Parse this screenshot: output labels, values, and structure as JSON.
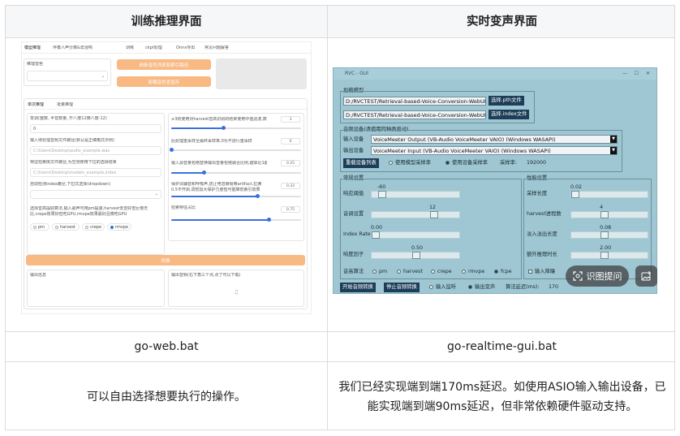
{
  "headers": {
    "training": "训练推理界面",
    "realtime": "实时变声界面"
  },
  "files": {
    "web": "go-web.bat",
    "gui": "go-realtime-gui.bat"
  },
  "descriptions": {
    "web": "可以自由选择想要执行的操作。",
    "gui": "我们已经实现端到端170ms延迟。如使用ASIO输入输出设备，已能实现端到端90ms延迟，但非常依赖硬件驱动支持。"
  },
  "web_ui": {
    "tabs": [
      "模型推理",
      "伴奏人声分离&去混响",
      "训练",
      "ckpt处理",
      "Onnx导出",
      "常见问题解答"
    ],
    "model_label": "推理音色",
    "refresh_button": "刷新音色列表和索引路径",
    "unload_button": "卸载音色省显存",
    "subtabs": [
      "单次推理",
      "批量推理"
    ],
    "left_labels": [
      "变调(整数, 半音数量, 升八度12降八度-12)",
      "输入待处理音频文件路径(默认是正确格式示例)",
      "特征检索库文件路径,为空则使用下拉的选择结果",
      "自动检测index路径,下拉式选择(dropdown)",
      "选择音高提取算法,输入歌声可用pm提速,harvest低音好但巨慢无比,crepe效果好但吃GPU,rmvpe效果最好且微吃GPU"
    ],
    "pitch_value": "0",
    "audio_path": "C:\\Users\\Desktop\\audio_example.wav",
    "index_path": "C:\\Users\\Desktop\\models_example.index",
    "algos": [
      "pm",
      "harvest",
      "crepe",
      "rmvpe"
    ],
    "selected_algo": "rmvpe",
    "right_labels": [
      "≥3则使用对harvest音高识别的结果使用中值滤波,数值为滤波半径,使用可以削弱哑音",
      "后处理重采样至最终采样率,0为不进行重采样",
      "输入源音量包络替换输出音量包络融合比例,越靠近1越使用输出包络",
      "保护清辅音和呼吸声,防止电音撕裂等artifact,拉满0.5不开启,调低加大保护力度但可能降低索引效果",
      "检索特征占比"
    ],
    "right_values": [
      "3",
      "0",
      "0.25",
      "0.33",
      "0.75"
    ],
    "right_fracs": [
      0.4,
      0,
      0.25,
      0.66,
      0.75
    ],
    "convert_button": "转换",
    "output_info": "输出信息",
    "output_audio": "输出音频(右下角三个点,点了可以下载)"
  },
  "gui_ui": {
    "title": "RVC - GUI",
    "load_model": "加载模型",
    "pth_path": "D:/RVCTEST/Retrieval-based-Voice-Conversion-WebUI",
    "index_path": "D:/RVCTEST/Retrieval-based-Voice-Conversion-WebUI",
    "pth_button": "选择.pth文件",
    "index_button": "选择.index文件",
    "audio_device": "音频设备(请使用同种类驱动)",
    "input_label": "输入设备",
    "output_label": "输出设备",
    "input_device": "VoiceMeeter Output (VB-Audio VoiceMeeter VAIO) (Windows WASAPI)",
    "output_device": "VoiceMeeter Input (VB-Audio VoiceMeeter VAIO) (Windows WASAPI)",
    "reload_button": "重载设备列表",
    "sr_model": "使用模型采样率",
    "sr_device": "使用设备采样率",
    "sr_label": "采样率:",
    "sr_value": "192000",
    "general": "常规设置",
    "perf": "性能设置",
    "left_sliders": [
      {
        "label": "响应阈值",
        "value": "-60",
        "frac": 0.08
      },
      {
        "label": "音调设置",
        "value": "12",
        "frac": 0.72
      },
      {
        "label": "Index Rate",
        "value": "0.00",
        "frac": 0.0
      },
      {
        "label": "响度因子",
        "value": "0.50",
        "frac": 0.5
      }
    ],
    "right_sliders": [
      {
        "label": "采样长度",
        "value": "0.02",
        "frac": 0.0
      },
      {
        "label": "harvest进程数",
        "value": "4",
        "frac": 0.42
      },
      {
        "label": "淡入淡出长度",
        "value": "0.08",
        "frac": 0.42
      },
      {
        "label": "额外推理时长",
        "value": "2.00",
        "frac": 0.42
      }
    ],
    "algo_label": "音高算法",
    "algos": [
      "pm",
      "harvest",
      "crepe",
      "rmvpe",
      "fcpe"
    ],
    "selected_algo": "fcpe",
    "noise_reduce": "输入降噪",
    "start_button": "开始音频转换",
    "stop_button": "停止音频转换",
    "monitor_in": "输入监听",
    "monitor_out": "输出变声",
    "delay_label": "算法延迟(ms):",
    "delay_value": "170",
    "overlay_text": "识图提问"
  }
}
